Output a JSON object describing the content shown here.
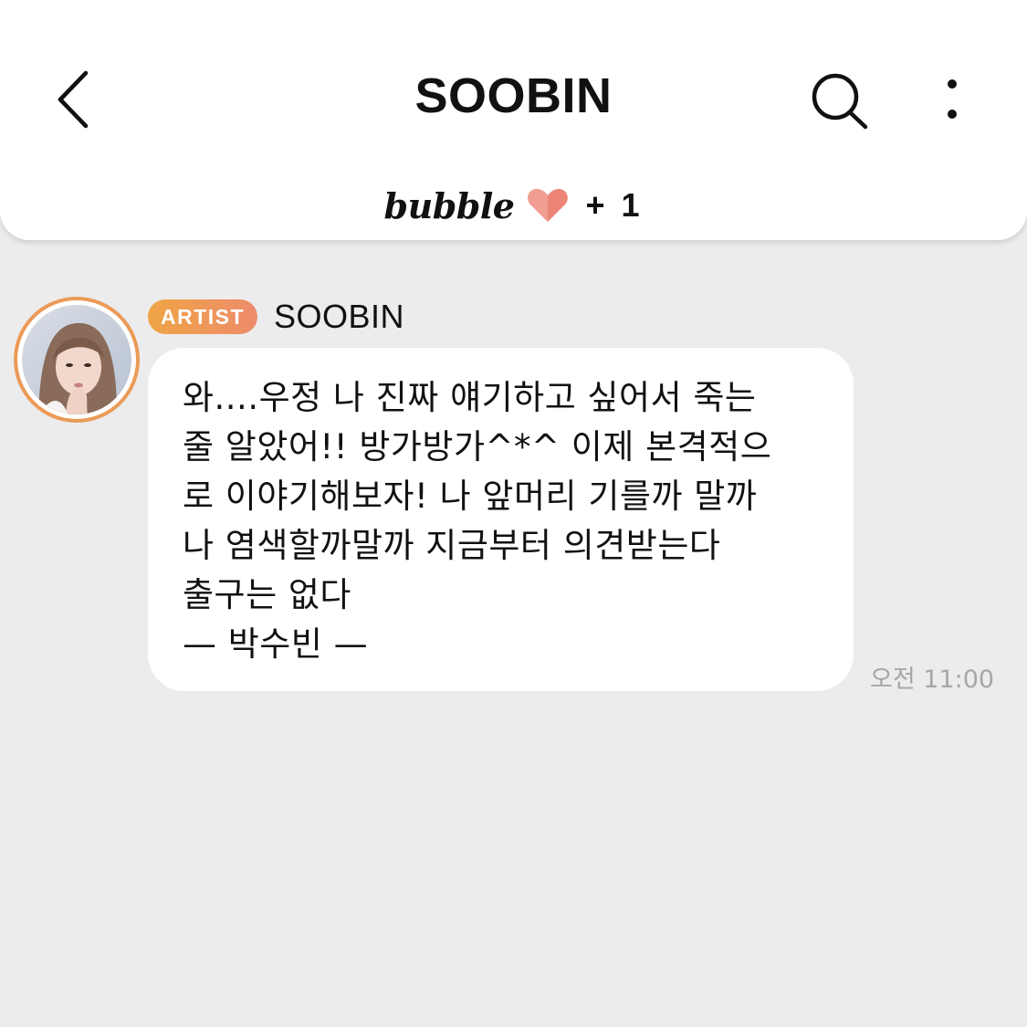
{
  "header": {
    "title": "SOOBIN",
    "back_icon": "chevron-left-icon",
    "search_icon": "search-icon",
    "more_icon": "more-vertical-icon"
  },
  "subscription": {
    "brand": "bubble",
    "heart_icon": "heart-icon",
    "count": "+ 1"
  },
  "message": {
    "badge": "ARTIST",
    "sender": "SOOBIN",
    "lines": [
      "와....우정 나 진짜 얘기하고 싶어서 죽는",
      "줄 알았어!! 방가방가^*^ 이제 본격적으",
      "로 이야기해보자! 나 앞머리 기를까 말까",
      "나 염색할까말까 지금부터 의견받는다",
      "출구는 없다",
      "— 박수빈 —"
    ],
    "time": "오전 11:00"
  },
  "colors": {
    "background": "#ececed",
    "header_bg": "#ffffff",
    "badge_start": "#eea545",
    "badge_end": "#ee8b6c",
    "avatar_ring": "#eb9a57",
    "heart": "#ec8577",
    "timestamp": "#a6a6a6"
  }
}
